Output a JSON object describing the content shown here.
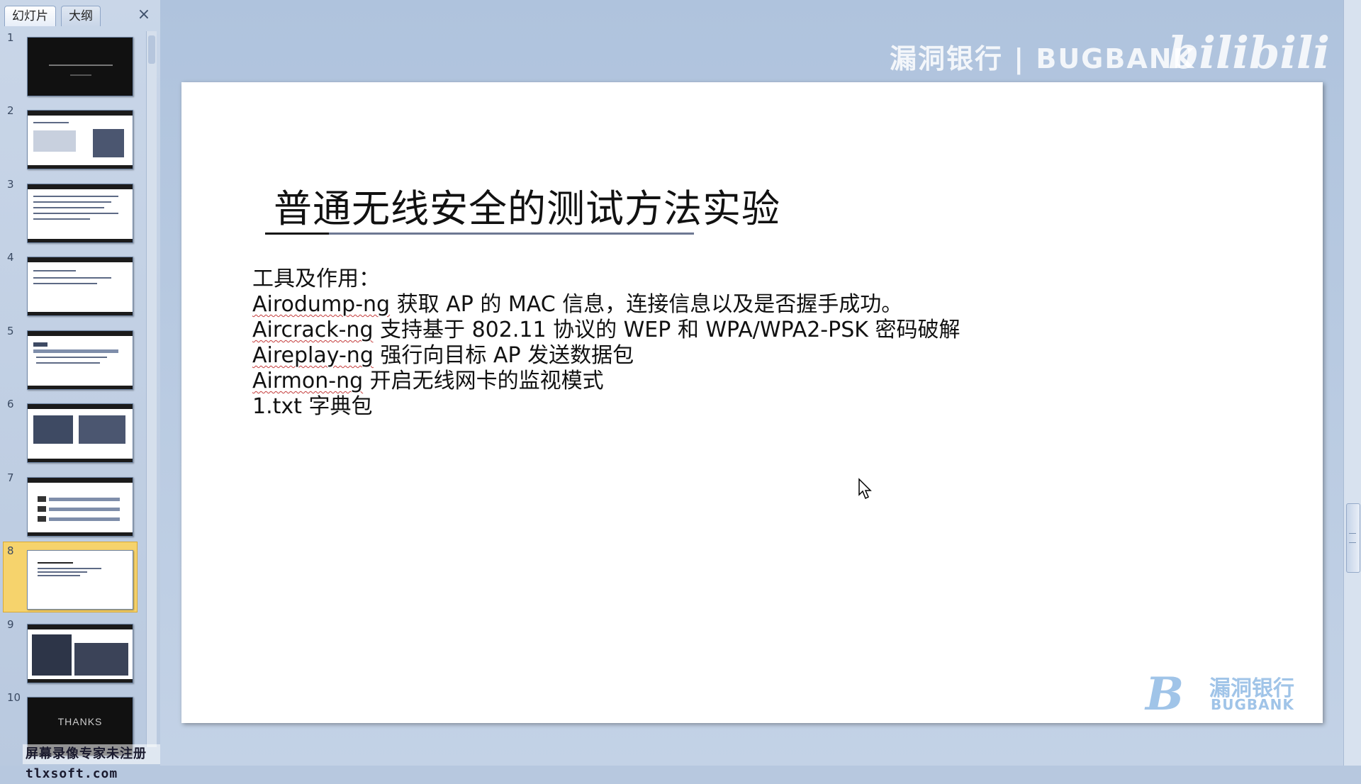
{
  "left_panel": {
    "tabs": [
      "幻灯片",
      "大纲"
    ],
    "close_glyph": "×",
    "slides": [
      {
        "number": "1",
        "style": "dark"
      },
      {
        "number": "2",
        "style": "light-dark-header"
      },
      {
        "number": "3",
        "style": "light-dark-header"
      },
      {
        "number": "4",
        "style": "light-dark-header"
      },
      {
        "number": "5",
        "style": "light-dark-header"
      },
      {
        "number": "6",
        "style": "light-dark-header"
      },
      {
        "number": "7",
        "style": "light-dark-header"
      },
      {
        "number": "8",
        "style": "light",
        "selected": true
      },
      {
        "number": "9",
        "style": "light-dark-header"
      },
      {
        "number": "10",
        "style": "dark",
        "text": "THANKS"
      }
    ],
    "registration_watermark": "屏幕录像专家未注册 tlxsoft.com"
  },
  "workspace": {
    "brand_watermark": "漏洞银行 | BUGBANK",
    "bili_logo": "bilibili",
    "slide": {
      "title": "普通无线安全的测试方法实验",
      "lines": [
        {
          "tool": "",
          "text": "工具及作用："
        },
        {
          "tool": "Airodump-ng",
          "text": " 获取 AP 的 MAC 信息，连接信息以及是否握手成功。"
        },
        {
          "tool": "Aircrack-ng",
          "text": " 支持基于 802.11 协议的 WEP 和 WPA/WPA2-PSK 密码破解"
        },
        {
          "tool": "Aireplay-ng",
          "text": " 强行向目标 AP 发送数据包"
        },
        {
          "tool": "Airmon-ng",
          "text": " 开启无线网卡的监视模式"
        },
        {
          "tool": "",
          "text": "1.txt 字典包"
        }
      ],
      "logo": {
        "letter": "B",
        "cn": "漏洞银行",
        "en": "BUGBANK"
      }
    }
  },
  "colors": {
    "accent_selected": "#f6d36c",
    "slide_bg": "#ffffff",
    "workspace_bg": "#b7c8df"
  }
}
